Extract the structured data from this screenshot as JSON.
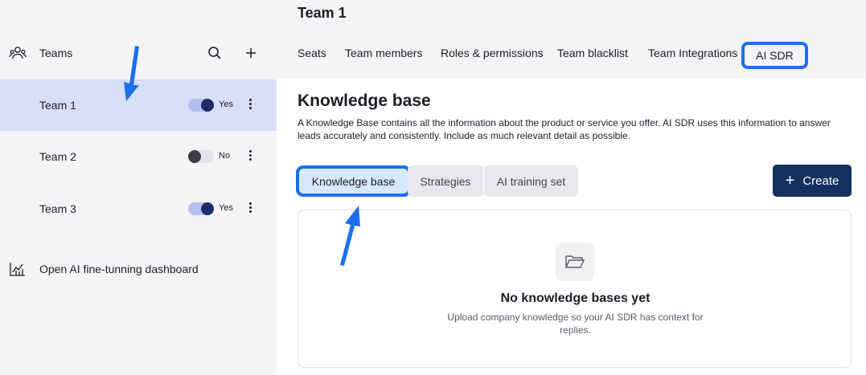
{
  "sidebar": {
    "title": "Teams",
    "teams": [
      {
        "name": "Team 1",
        "toggle": "on",
        "toggle_label": "Yes"
      },
      {
        "name": "Team 2",
        "toggle": "off",
        "toggle_label": "No"
      },
      {
        "name": "Team 3",
        "toggle": "on",
        "toggle_label": "Yes"
      }
    ],
    "dashboard_link": "Open AI fine-tunning dashboard"
  },
  "header": {
    "title": "Team 1",
    "tabs": [
      "Seats",
      "Team members",
      "Roles & permissions",
      "Team blacklist",
      "Team Integrations",
      "AI SDR"
    ],
    "active_tab": "AI SDR"
  },
  "section": {
    "title": "Knowledge base",
    "description": "A Knowledge Base contains all the information about the product or service you offer. AI SDR uses this information to answer leads accurately and consistently. Include as much relevant detail as possible.",
    "subtabs": [
      "Knowledge base",
      "Strategies",
      "AI training set"
    ],
    "active_subtab": "Knowledge base",
    "create_label": "Create"
  },
  "empty_state": {
    "title": "No knowledge bases yet",
    "description": "Upload company knowledge so your AI SDR has context for replies."
  },
  "colors": {
    "accent_highlight": "#1a6ff0",
    "primary_button": "#13305e",
    "active_row": "#d9ddf6",
    "toggle_on_knob": "#1e2a6e"
  },
  "icons": [
    "teams-icon",
    "search-icon",
    "plus-icon",
    "kebab-icon",
    "chart-icon",
    "folder-icon",
    "annotation-arrow"
  ]
}
